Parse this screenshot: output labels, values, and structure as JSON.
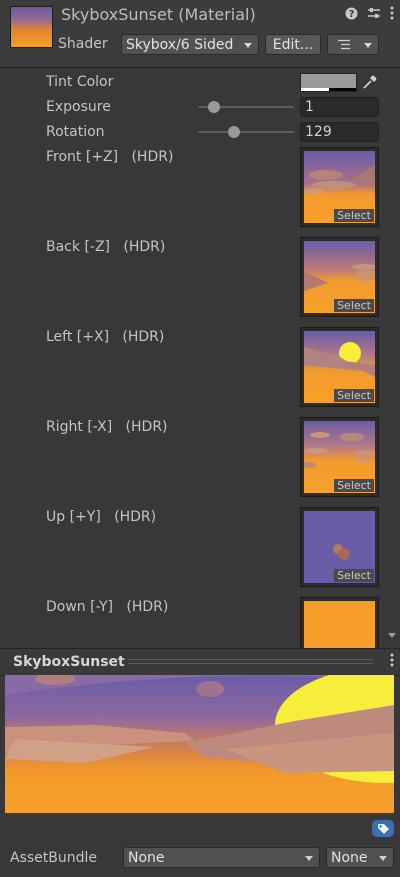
{
  "header": {
    "title": "SkyboxSunset (Material)",
    "shader_label": "Shader",
    "shader_value": "Skybox/6 Sided",
    "edit_label": "Edit..."
  },
  "properties": {
    "tint_color_label": "Tint Color",
    "exposure_label": "Exposure",
    "exposure_value": "1",
    "rotation_label": "Rotation",
    "rotation_value": "129",
    "textures": [
      {
        "label": "Front [+Z]",
        "hdr": "(HDR)",
        "select": "Select"
      },
      {
        "label": "Back [-Z]",
        "hdr": "(HDR)",
        "select": "Select"
      },
      {
        "label": "Left [+X]",
        "hdr": "(HDR)",
        "select": "Select"
      },
      {
        "label": "Right [-X]",
        "hdr": "(HDR)",
        "select": "Select"
      },
      {
        "label": "Up [+Y]",
        "hdr": "(HDR)",
        "select": "Select"
      },
      {
        "label": "Down [-Y]",
        "hdr": "(HDR)",
        "select": ""
      }
    ]
  },
  "preview": {
    "title": "SkyboxSunset"
  },
  "footer": {
    "assetbundle_label": "AssetBundle",
    "bundle_value": "None",
    "variant_value": "None"
  },
  "colors": {
    "background": "#383838",
    "sky_purple": "#6a5ca6",
    "sky_orange": "#f59b2a",
    "sun_yellow": "#f6ee3a",
    "tag_blue": "#3b6fb3"
  },
  "icons": [
    "help-icon",
    "preset-icon",
    "more-icon",
    "eyedropper-icon",
    "tag-icon"
  ]
}
